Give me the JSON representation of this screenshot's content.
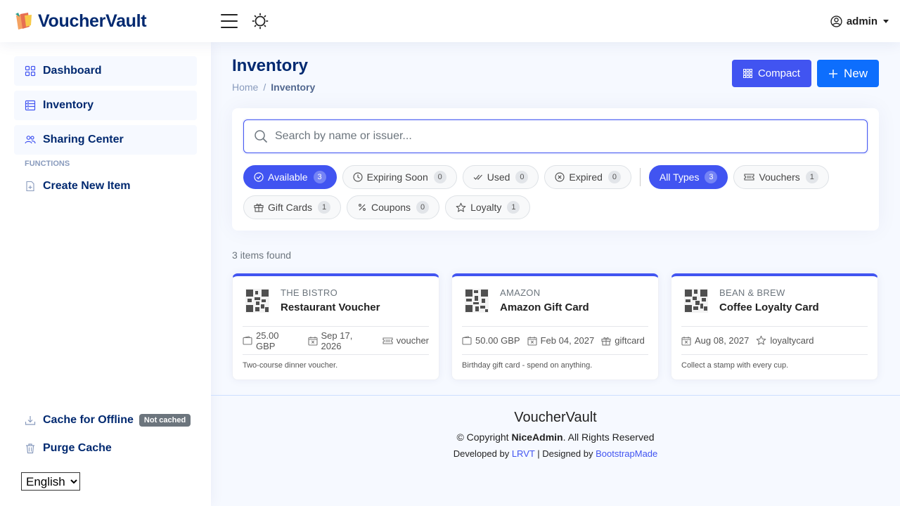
{
  "header": {
    "app_name": "VoucherVault",
    "user_name": "admin"
  },
  "sidebar": {
    "items": [
      {
        "label": "Dashboard"
      },
      {
        "label": "Inventory"
      },
      {
        "label": "Sharing Center"
      }
    ],
    "functions_heading": "FUNCTIONS",
    "create_label": "Create New Item",
    "cache_label": "Cache for Offline",
    "cache_badge": "Not cached",
    "purge_label": "Purge Cache",
    "language": "English"
  },
  "page": {
    "title": "Inventory",
    "breadcrumb_home": "Home",
    "breadcrumb_sep": "/",
    "breadcrumb_current": "Inventory",
    "compact_label": "Compact",
    "new_label": "New"
  },
  "filters": {
    "search_placeholder": "Search by name or issuer...",
    "status": [
      {
        "label": "Available",
        "count": "3",
        "active": true
      },
      {
        "label": "Expiring Soon",
        "count": "0"
      },
      {
        "label": "Used",
        "count": "0"
      },
      {
        "label": "Expired",
        "count": "0"
      }
    ],
    "types": [
      {
        "label": "All Types",
        "count": "3",
        "active": true
      },
      {
        "label": "Vouchers",
        "count": "1"
      },
      {
        "label": "Gift Cards",
        "count": "1"
      },
      {
        "label": "Coupons",
        "count": "0"
      },
      {
        "label": "Loyalty",
        "count": "1"
      }
    ]
  },
  "results": {
    "count_text": "3 items found",
    "items": [
      {
        "issuer": "THE BISTRO",
        "name": "Restaurant Voucher",
        "value": "25.00 GBP",
        "expiry": "Sep 17, 2026",
        "type": "voucher",
        "description": "Two-course dinner voucher."
      },
      {
        "issuer": "AMAZON",
        "name": "Amazon Gift Card",
        "value": "50.00 GBP",
        "expiry": "Feb 04, 2027",
        "type": "giftcard",
        "description": "Birthday gift card - spend on anything."
      },
      {
        "issuer": "BEAN & BREW",
        "name": "Coffee Loyalty Card",
        "expiry": "Aug 08, 2027",
        "type": "loyaltycard",
        "description": "Collect a stamp with every cup."
      }
    ]
  },
  "footer": {
    "title": "VoucherVault",
    "copyright_prefix": "© Copyright",
    "copyright_brand": "NiceAdmin",
    "copyright_suffix": ". All Rights Reserved",
    "developed_by": "Developed by",
    "developer": "LRVT",
    "designed_by": "| Designed by",
    "designer": "BootstrapMade"
  },
  "colors": {
    "accent": "#4154f1",
    "primary_button": "#0d6efd",
    "navy_text": "#012970",
    "background": "#f6f9ff"
  }
}
